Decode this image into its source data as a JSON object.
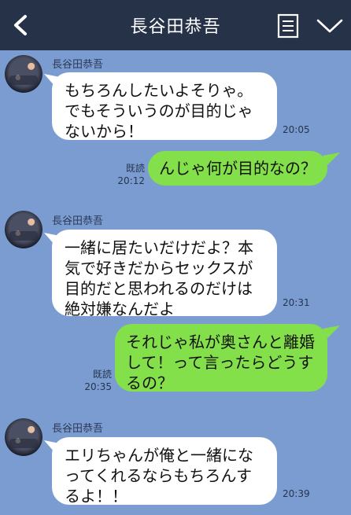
{
  "header": {
    "title": "長谷田恭吾"
  },
  "messages": [
    {
      "sender": "長谷田恭吾",
      "text": "もちろんしたいよそりゃ。でもそういうのが目的じゃないから！",
      "time": "20:05"
    },
    {
      "sender": "me",
      "text": "んじゃ何が目的なの？",
      "read": "既読",
      "time": "20:12"
    },
    {
      "sender": "長谷田恭吾",
      "text": "一緒に居たいだけだよ？本気で好きだからセックスが目的だと思われるのだけは絶対嫌なんだよ",
      "time": "20:31"
    },
    {
      "sender": "me",
      "text": "それじゃ私が奥さんと離婚して！って言ったらどうするの？",
      "read": "既読",
      "time": "20:35"
    },
    {
      "sender": "長谷田恭吾",
      "text": "エリちゃんが俺と一緒になってくれるならもちろんするよ！！",
      "time": "20:39"
    }
  ],
  "icons": [
    "back-arrow-icon",
    "menu-list-icon",
    "chevron-down-icon"
  ],
  "colors": {
    "header": "#253247",
    "background": "#7b9cd1",
    "incoming_bubble": "#ffffff",
    "outgoing_bubble": "#84e04a"
  }
}
